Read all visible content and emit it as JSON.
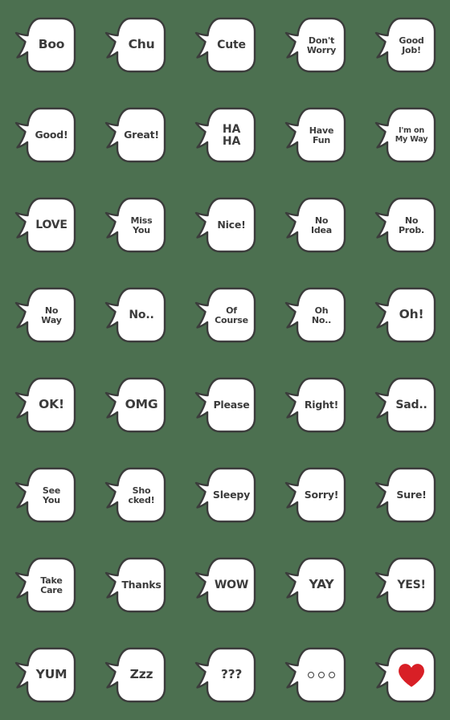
{
  "sheet": {
    "title": "Speech Bubble Emoji Sheet",
    "background_color": "#4c7050",
    "bubble_fill": "#ffffff",
    "bubble_stroke": "#3b3b3b",
    "text_color": "#3b3b3b",
    "heart_color": "#d81f26",
    "columns": 5,
    "rows": 8,
    "total": 40
  },
  "emojis": [
    {
      "id": "boo",
      "text": "Boo",
      "lines": [
        "Boo"
      ],
      "size": "sz-1",
      "kind": "text"
    },
    {
      "id": "chu",
      "text": "Chu",
      "lines": [
        "Chu"
      ],
      "size": "sz-1",
      "kind": "text"
    },
    {
      "id": "cute",
      "text": "Cute",
      "lines": [
        "Cute"
      ],
      "size": "sz-2",
      "kind": "text"
    },
    {
      "id": "dont-worry",
      "text": "Don't Worry",
      "lines": [
        "Don't",
        "Worry"
      ],
      "size": "sz-4",
      "kind": "text"
    },
    {
      "id": "good-job",
      "text": "Good Job!",
      "lines": [
        "Good",
        "Job!"
      ],
      "size": "sz-4",
      "kind": "text"
    },
    {
      "id": "good",
      "text": "Good!",
      "lines": [
        "Good!"
      ],
      "size": "sz-3",
      "kind": "text"
    },
    {
      "id": "great",
      "text": "Great!",
      "lines": [
        "Great!"
      ],
      "size": "sz-3",
      "kind": "text"
    },
    {
      "id": "ha-ha",
      "text": "HA HA",
      "lines": [
        "HA",
        "HA"
      ],
      "size": "sz-2",
      "kind": "text"
    },
    {
      "id": "have-fun",
      "text": "Have Fun",
      "lines": [
        "Have",
        "Fun"
      ],
      "size": "sz-4",
      "kind": "text"
    },
    {
      "id": "im-on-my-way",
      "text": "I'm on My Way",
      "lines": [
        "I'm on",
        "My Way"
      ],
      "size": "sz-5",
      "kind": "text"
    },
    {
      "id": "love",
      "text": "LOVE",
      "lines": [
        "LOVE"
      ],
      "size": "sz-2",
      "kind": "text"
    },
    {
      "id": "miss-you",
      "text": "Miss You",
      "lines": [
        "Miss",
        "You"
      ],
      "size": "sz-4",
      "kind": "text"
    },
    {
      "id": "nice",
      "text": "Nice!",
      "lines": [
        "Nice!"
      ],
      "size": "sz-3",
      "kind": "text"
    },
    {
      "id": "no-idea",
      "text": "No Idea",
      "lines": [
        "No",
        "Idea"
      ],
      "size": "sz-4",
      "kind": "text"
    },
    {
      "id": "no-prob",
      "text": "No Prob.",
      "lines": [
        "No",
        "Prob."
      ],
      "size": "sz-4",
      "kind": "text"
    },
    {
      "id": "no-way",
      "text": "No Way",
      "lines": [
        "No",
        "Way"
      ],
      "size": "sz-4",
      "kind": "text"
    },
    {
      "id": "no-dots",
      "text": "No..",
      "lines": [
        "No.."
      ],
      "size": "sz-2",
      "kind": "text"
    },
    {
      "id": "of-course",
      "text": "Of Course",
      "lines": [
        "Of",
        "Course"
      ],
      "size": "sz-4",
      "kind": "text"
    },
    {
      "id": "oh-no",
      "text": "Oh No..",
      "lines": [
        "Oh",
        "No.."
      ],
      "size": "sz-4",
      "kind": "text"
    },
    {
      "id": "oh",
      "text": "Oh!",
      "lines": [
        "Oh!"
      ],
      "size": "sz-1",
      "kind": "text"
    },
    {
      "id": "ok",
      "text": "OK!",
      "lines": [
        "OK!"
      ],
      "size": "sz-1",
      "kind": "text"
    },
    {
      "id": "omg",
      "text": "OMG",
      "lines": [
        "OMG"
      ],
      "size": "sz-1",
      "kind": "text"
    },
    {
      "id": "please",
      "text": "Please",
      "lines": [
        "Please"
      ],
      "size": "sz-3",
      "kind": "text"
    },
    {
      "id": "right",
      "text": "Right!",
      "lines": [
        "Right!"
      ],
      "size": "sz-3",
      "kind": "text"
    },
    {
      "id": "sad",
      "text": "Sad..",
      "lines": [
        "Sad.."
      ],
      "size": "sz-2",
      "kind": "text"
    },
    {
      "id": "see-you",
      "text": "See You",
      "lines": [
        "See",
        "You"
      ],
      "size": "sz-4",
      "kind": "text"
    },
    {
      "id": "shocked",
      "text": "Shocked!",
      "lines": [
        "Sho",
        "cked!"
      ],
      "size": "sz-4",
      "kind": "text"
    },
    {
      "id": "sleepy",
      "text": "Sleepy",
      "lines": [
        "Sleepy"
      ],
      "size": "sz-3",
      "kind": "text"
    },
    {
      "id": "sorry",
      "text": "Sorry!",
      "lines": [
        "Sorry!"
      ],
      "size": "sz-3",
      "kind": "text"
    },
    {
      "id": "sure",
      "text": "Sure!",
      "lines": [
        "Sure!"
      ],
      "size": "sz-3",
      "kind": "text"
    },
    {
      "id": "take-care",
      "text": "Take Care",
      "lines": [
        "Take",
        "Care"
      ],
      "size": "sz-4",
      "kind": "text"
    },
    {
      "id": "thanks",
      "text": "Thanks",
      "lines": [
        "Thanks"
      ],
      "size": "sz-3",
      "kind": "text"
    },
    {
      "id": "wow",
      "text": "WOW",
      "lines": [
        "WOW"
      ],
      "size": "sz-2",
      "kind": "text"
    },
    {
      "id": "yay",
      "text": "YAY",
      "lines": [
        "YAY"
      ],
      "size": "sz-1",
      "kind": "text"
    },
    {
      "id": "yes",
      "text": "YES!",
      "lines": [
        "YES!"
      ],
      "size": "sz-2",
      "kind": "text"
    },
    {
      "id": "yum",
      "text": "YUM",
      "lines": [
        "YUM"
      ],
      "size": "sz-1",
      "kind": "text"
    },
    {
      "id": "zzz",
      "text": "Zzz",
      "lines": [
        "Zzz"
      ],
      "size": "sz-1",
      "kind": "text"
    },
    {
      "id": "question-marks",
      "text": "???",
      "lines": [
        "???"
      ],
      "size": "sz-1",
      "kind": "text"
    },
    {
      "id": "ellipsis",
      "text": "...",
      "lines": [],
      "size": "sz-1",
      "kind": "dots"
    },
    {
      "id": "heart",
      "text": "heart",
      "lines": [],
      "size": "sz-1",
      "kind": "heart"
    }
  ]
}
